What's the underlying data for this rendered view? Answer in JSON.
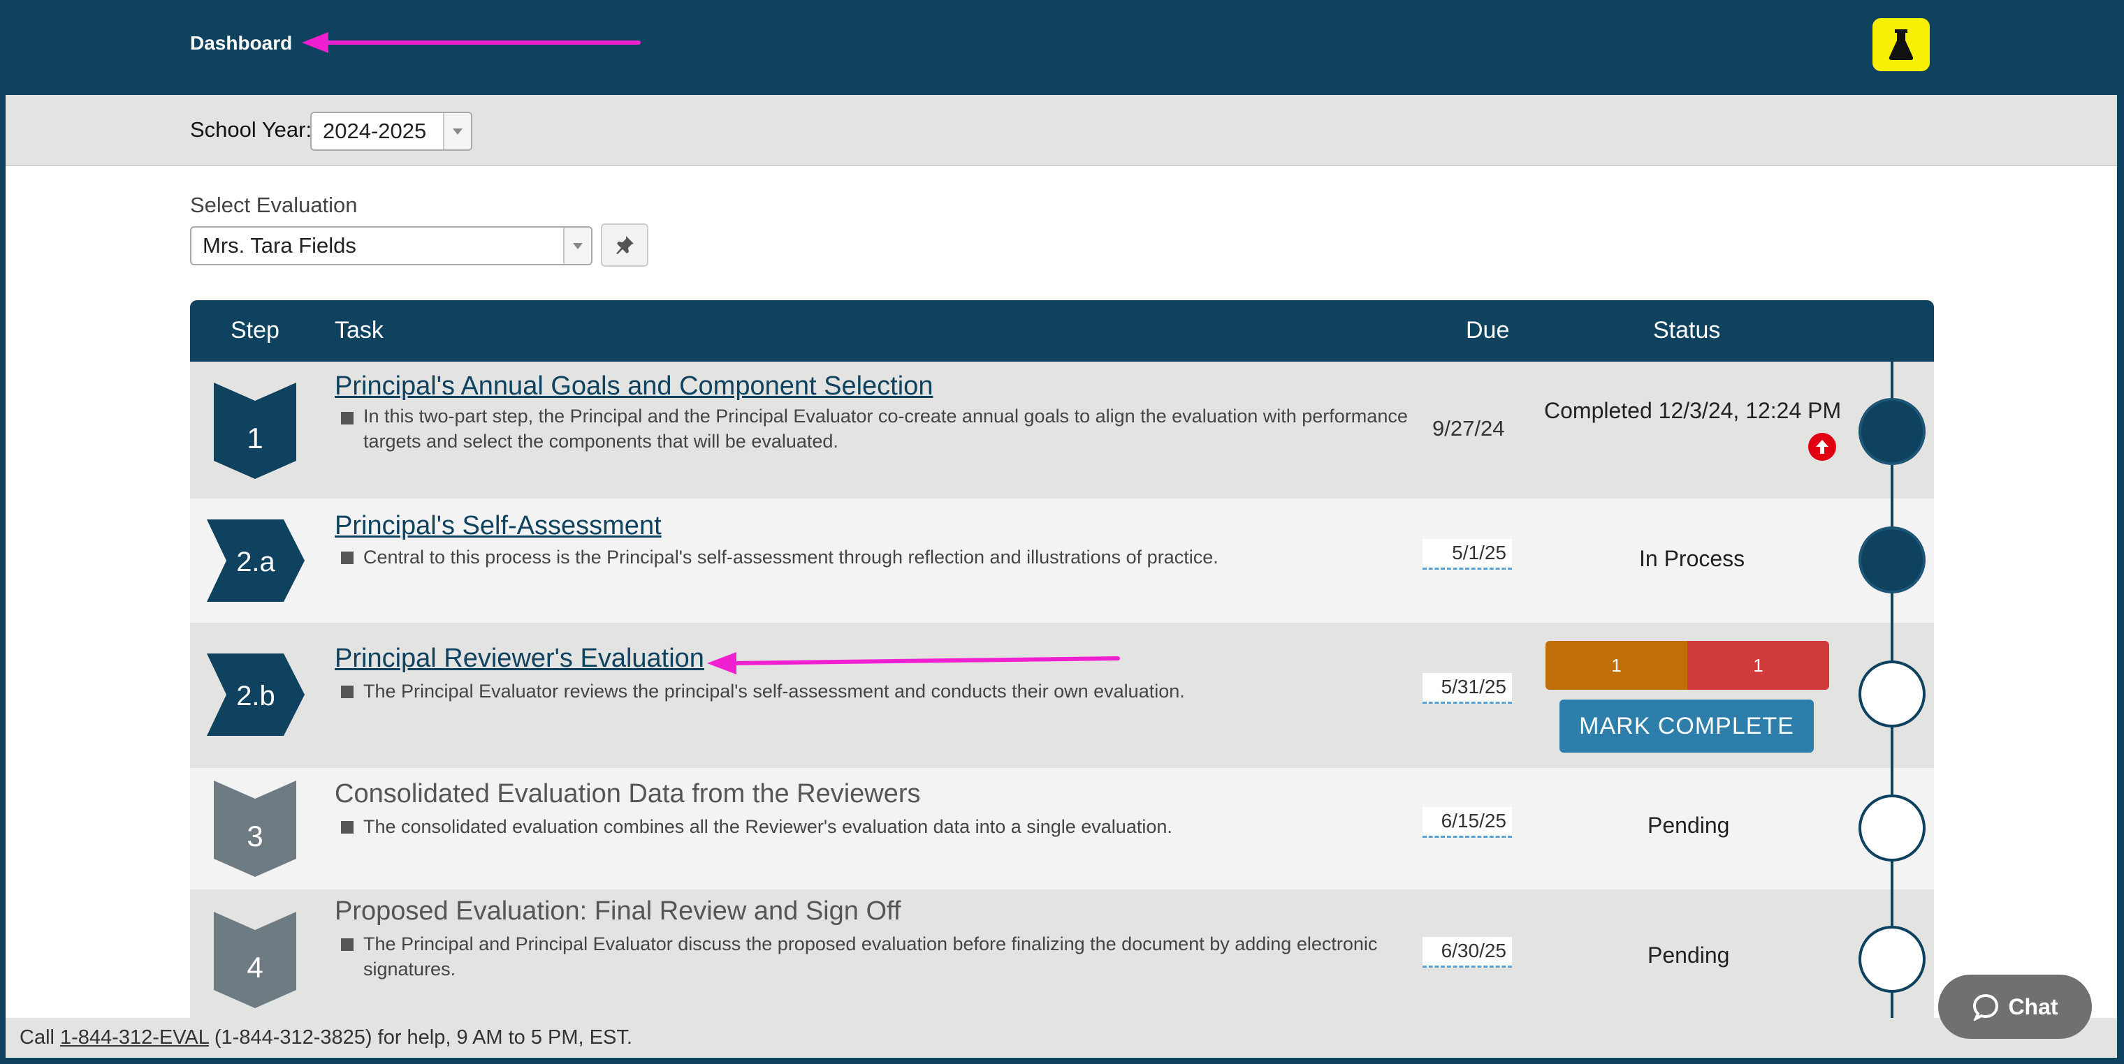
{
  "header": {
    "title": "Dashboard"
  },
  "school_year": {
    "label": "School Year:",
    "value": "2024-2025"
  },
  "evaluation": {
    "label": "Select Evaluation",
    "value": "Mrs. Tara Fields"
  },
  "table": {
    "columns": {
      "step": "Step",
      "task": "Task",
      "due": "Due",
      "status": "Status"
    },
    "rows": [
      {
        "step": "1",
        "title": "Principal's Annual Goals and Component Selection",
        "desc": "In this two-part step, the Principal and the Principal Evaluator co-create annual goals to align the evaluation with performance targets and select the components that will be evaluated.",
        "due": "9/27/24",
        "status": "Completed 12/3/24, 12:24 PM"
      },
      {
        "step": "2.a",
        "title": "Principal's Self-Assessment",
        "desc": "Central to this process is the Principal's self-assessment through reflection and illustrations of practice.",
        "due": "5/1/25",
        "status": "In Process"
      },
      {
        "step": "2.b",
        "title": "Principal Reviewer's Evaluation",
        "desc": "The Principal Evaluator reviews the principal's self-assessment and conducts their own evaluation.",
        "due": "5/31/25",
        "progress": {
          "orange": "1",
          "red": "1"
        },
        "button": "MARK COMPLETE"
      },
      {
        "step": "3",
        "title": "Consolidated Evaluation Data from the Reviewers",
        "desc": "The consolidated evaluation combines all the Reviewer's evaluation data into a single evaluation.",
        "due": "6/15/25",
        "status": "Pending"
      },
      {
        "step": "4",
        "title": "Proposed Evaluation: Final Review and Sign Off",
        "desc": "The Principal and Principal Evaluator discuss the proposed evaluation before finalizing the document by adding electronic signatures.",
        "due": "6/30/25",
        "status": "Pending"
      }
    ]
  },
  "footer": {
    "prefix": "Call ",
    "phone_link": "1-844-312-EVAL",
    "suffix": " (1-844-312-3825) for help, 9 AM to 5 PM, EST."
  },
  "chat": {
    "label": "Chat"
  },
  "colors": {
    "primary": "#0e425f",
    "accent": "#2d7eab",
    "magenta": "#f020d0",
    "orange": "#c06f08",
    "red": "#d03a3a"
  }
}
